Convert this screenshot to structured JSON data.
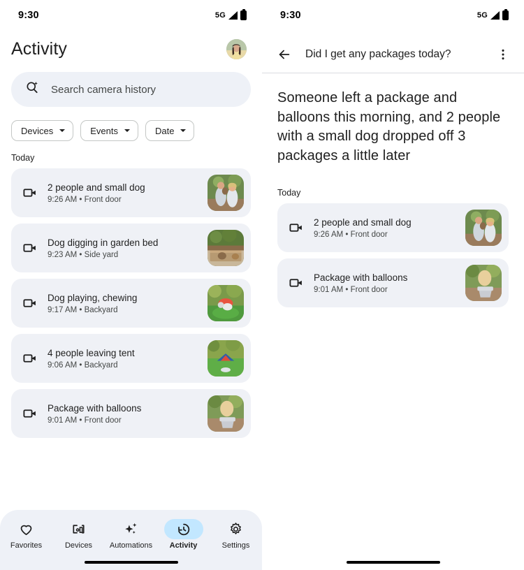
{
  "status_bar": {
    "time": "9:30",
    "network": "5G"
  },
  "colors": {
    "card_bg": "#eff1f6",
    "search_bg": "#eef1f7",
    "nav_bg": "#eef1f7",
    "active_pill": "#c2e7ff",
    "text_primary": "#1f1f1f",
    "text_secondary": "#444746",
    "divider": "#dadce0"
  },
  "left_panel": {
    "title": "Activity",
    "avatar_name": "user-avatar",
    "search": {
      "placeholder": "Search camera history",
      "icon": "ai-search-icon",
      "value": ""
    },
    "filters": [
      {
        "label": "Devices",
        "icon": "chevron-down-icon"
      },
      {
        "label": "Events",
        "icon": "chevron-down-icon"
      },
      {
        "label": "Date",
        "icon": "chevron-down-icon"
      }
    ],
    "section_label": "Today",
    "events": [
      {
        "title": "2 people and small dog",
        "time": "9:26 AM",
        "location": "Front door",
        "subtitle": "9:26 AM • Front door",
        "icon": "video-camera-icon",
        "thumb": "people-dog"
      },
      {
        "title": "Dog digging in garden bed",
        "time": "9:23 AM",
        "location": "Side yard",
        "subtitle": "9:23 AM • Side yard",
        "icon": "video-camera-icon",
        "thumb": "garden-bed"
      },
      {
        "title": "Dog playing, chewing",
        "time": "9:17 AM",
        "location": "Backyard",
        "subtitle": "9:17 AM • Backyard",
        "icon": "video-camera-icon",
        "thumb": "dog-playing"
      },
      {
        "title": "4 people leaving tent",
        "time": "9:06 AM",
        "location": "Backyard",
        "subtitle": "9:06 AM • Backyard",
        "icon": "video-camera-icon",
        "thumb": "tent"
      },
      {
        "title": "Package with balloons",
        "time": "9:01 AM",
        "location": "Front door",
        "subtitle": "9:01 AM • Front door",
        "icon": "video-camera-icon",
        "thumb": "balloons"
      }
    ],
    "bottom_nav": [
      {
        "label": "Favorites",
        "icon": "heart-icon",
        "active": false
      },
      {
        "label": "Devices",
        "icon": "devices-icon",
        "active": false
      },
      {
        "label": "Automations",
        "icon": "sparkles-icon",
        "active": false
      },
      {
        "label": "Activity",
        "icon": "history-icon",
        "active": true
      },
      {
        "label": "Settings",
        "icon": "gear-icon",
        "active": false
      }
    ]
  },
  "right_panel": {
    "back_icon": "back-arrow-icon",
    "query": "Did I get any packages today?",
    "overflow_icon": "more-vert-icon",
    "answer": "Someone left a package and balloons this morning, and 2 people with a small dog dropped off 3 packages a little later",
    "section_label": "Today",
    "events": [
      {
        "title": "2 people and small dog",
        "time": "9:26 AM",
        "location": "Front door",
        "subtitle": "9:26 AM • Front door",
        "icon": "video-camera-icon",
        "thumb": "people-dog"
      },
      {
        "title": "Package with balloons",
        "time": "9:01 AM",
        "location": "Front door",
        "subtitle": "9:01 AM • Front door",
        "icon": "video-camera-icon",
        "thumb": "balloons"
      }
    ]
  }
}
